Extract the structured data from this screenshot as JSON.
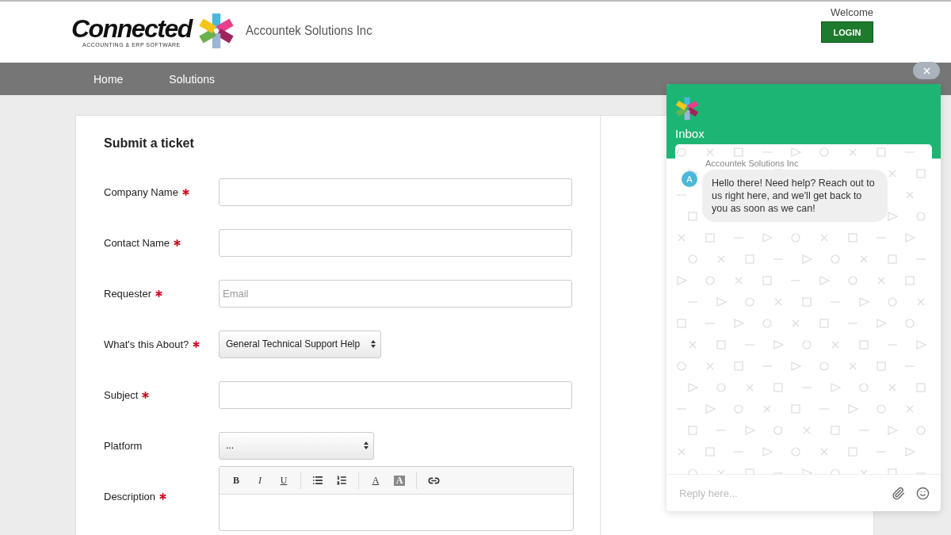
{
  "header": {
    "logo_word": "Connected",
    "logo_tagline": "ACCOUNTING & ERP SOFTWARE",
    "company": "Accountek Solutions Inc",
    "welcome": "Welcome",
    "login_button": "LOGIN"
  },
  "nav": {
    "items": [
      {
        "label": "Home"
      },
      {
        "label": "Solutions"
      }
    ]
  },
  "form": {
    "title": "Submit a ticket",
    "fields": [
      {
        "kind": "text",
        "label": "Company Name",
        "required": true
      },
      {
        "kind": "text",
        "label": "Contact Name",
        "required": true
      },
      {
        "kind": "text",
        "label": "Requester",
        "required": true,
        "placeholder": "Email"
      },
      {
        "kind": "select",
        "label": "What's this About?",
        "required": true,
        "value": "General Technical Support Help"
      },
      {
        "kind": "text",
        "label": "Subject",
        "required": true
      },
      {
        "kind": "select",
        "label": "Platform",
        "required": false,
        "value": "..."
      },
      {
        "kind": "editor",
        "label": "Description",
        "required": true
      }
    ],
    "toolbar": [
      {
        "kind": "bold",
        "label": "B"
      },
      {
        "kind": "italic",
        "label": "I"
      },
      {
        "kind": "underline",
        "label": "U"
      },
      {
        "kind": "divider"
      },
      {
        "kind": "bullets"
      },
      {
        "kind": "numbers"
      },
      {
        "kind": "divider"
      },
      {
        "kind": "color",
        "label": "A"
      },
      {
        "kind": "highlight",
        "label": "A"
      },
      {
        "kind": "divider"
      },
      {
        "kind": "link"
      }
    ]
  },
  "chat": {
    "title": "Inbox",
    "sender": "Accountek Solutions Inc",
    "avatar": "A",
    "message": "Hello there! Need help? Reach out to us right here, and we'll get back to you as soon as we can!",
    "reply_placeholder": "Reply here..."
  }
}
